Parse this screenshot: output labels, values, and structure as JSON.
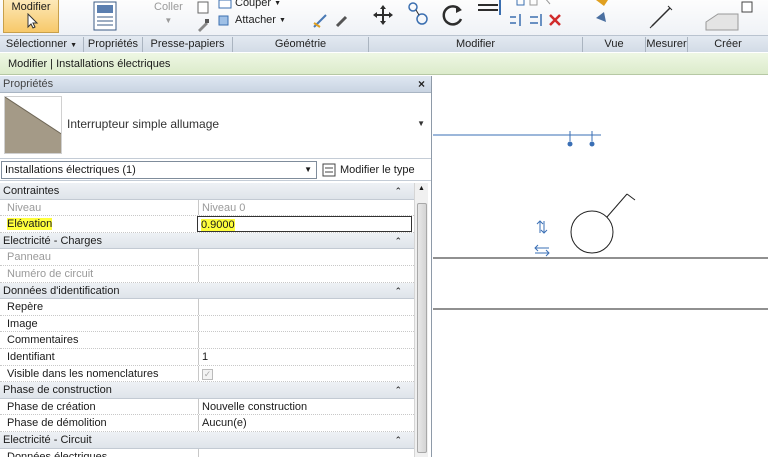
{
  "ribbon": {
    "modify_label": "Modifier",
    "paste_label": "Coller",
    "cut_label": "Couper",
    "attach_label": "Attacher",
    "panels": [
      "Sélectionner",
      "Propriétés",
      "Presse-papiers",
      "Géométrie",
      "Modifier",
      "Vue",
      "Mesurer",
      "Créer"
    ]
  },
  "context_bar": {
    "text": "Modifier | Installations électriques"
  },
  "properties": {
    "title": "Propriétés",
    "close": "×",
    "type_name": "Interrupteur simple allumage",
    "filter_value": "Installations électriques (1)",
    "edit_type_label": "Modifier le type",
    "groups": [
      {
        "name": "Contraintes",
        "rows": [
          {
            "key": "Niveau",
            "value": "Niveau 0",
            "greyed": true
          },
          {
            "key": "Elévation",
            "value": "0.9000",
            "highlight": true,
            "editing": true
          }
        ]
      },
      {
        "name": "Electricité - Charges",
        "rows": [
          {
            "key": "Panneau",
            "value": "",
            "greyed": true
          },
          {
            "key": "Numéro de circuit",
            "value": "",
            "greyed": true
          }
        ]
      },
      {
        "name": "Données d'identification",
        "rows": [
          {
            "key": "Repère",
            "value": ""
          },
          {
            "key": "Image",
            "value": ""
          },
          {
            "key": "Commentaires",
            "value": ""
          },
          {
            "key": "Identifiant",
            "value": "1"
          },
          {
            "key": "Visible dans les nomenclatures",
            "value": "",
            "checkbox": true
          }
        ]
      },
      {
        "name": "Phase de construction",
        "rows": [
          {
            "key": "Phase de création",
            "value": "Nouvelle construction"
          },
          {
            "key": "Phase de démolition",
            "value": "Aucun(e)"
          }
        ]
      },
      {
        "name": "Electricité - Circuit",
        "rows": [
          {
            "key": "Données électriques",
            "value": ""
          }
        ]
      }
    ]
  },
  "colors": {
    "highlight": "#ffff3c",
    "context_bar": "#dcebcb",
    "wire": "#3a6fb5"
  }
}
